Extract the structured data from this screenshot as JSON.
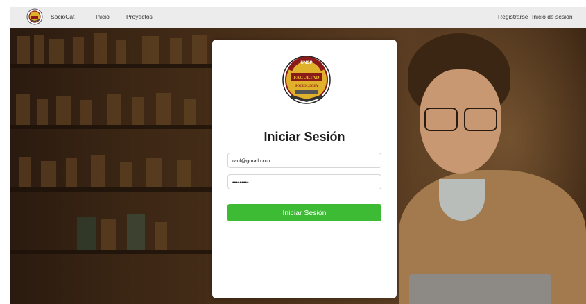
{
  "navbar": {
    "brand_name": "SocioCat",
    "links": [
      {
        "label": "Inicio"
      },
      {
        "label": "Proyectos"
      }
    ],
    "right_links": [
      {
        "label": "Registrarse"
      },
      {
        "label": "Inicio de sesión"
      }
    ]
  },
  "login": {
    "title": "Iniciar Sesión",
    "email_value": "raul@gmail.com",
    "password_value": "contraseñ",
    "submit_label": "Iniciar Sesión",
    "logo_text": {
      "arc": "UNCP",
      "main": "FACULTAD",
      "sub": "SOCIOLOGIA"
    }
  },
  "colors": {
    "accent": "#3ebb35",
    "navbar_bg": "#ececec",
    "logo_red": "#8b1a1a",
    "logo_gold": "#e0b12b"
  }
}
